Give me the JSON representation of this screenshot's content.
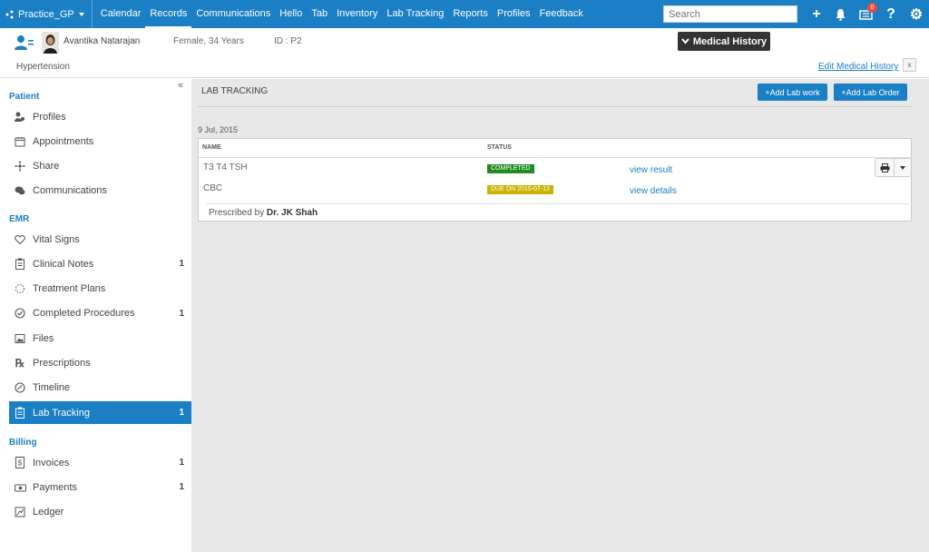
{
  "topbar": {
    "practice": "Practice_GP",
    "nav": [
      "Calendar",
      "Records",
      "Communications",
      "Hello",
      "Tab",
      "Inventory",
      "Lab Tracking",
      "Reports",
      "Profiles",
      "Feedback"
    ],
    "active_nav": "Records",
    "search_placeholder": "Search",
    "notification_count": "0",
    "accent": "#1a7fc4"
  },
  "patient": {
    "name": "Avantika Natarajan",
    "gender_age": "Female, 34 Years",
    "id": "ID : P2",
    "condition": "Hypertension",
    "medical_history_btn": "Medical History",
    "edit_medical_history": "Edit Medical History",
    "close": "x"
  },
  "sidebar": {
    "sections": [
      {
        "title": "Patient",
        "items": [
          {
            "label": "Profiles",
            "icon": "profiles-icon",
            "count": ""
          },
          {
            "label": "Appointments",
            "icon": "calendar-icon",
            "count": ""
          },
          {
            "label": "Share",
            "icon": "share-icon",
            "count": ""
          },
          {
            "label": "Communications",
            "icon": "chat-icon",
            "count": ""
          }
        ]
      },
      {
        "title": "EMR",
        "items": [
          {
            "label": "Vital Signs",
            "icon": "heart-icon",
            "count": ""
          },
          {
            "label": "Clinical Notes",
            "icon": "clipboard-icon",
            "count": "1"
          },
          {
            "label": "Treatment Plans",
            "icon": "dotted-circle-icon",
            "count": ""
          },
          {
            "label": "Completed Procedures",
            "icon": "check-circle-icon",
            "count": "1"
          },
          {
            "label": "Files",
            "icon": "image-icon",
            "count": ""
          },
          {
            "label": "Prescriptions",
            "icon": "rx-icon",
            "count": ""
          },
          {
            "label": "Timeline",
            "icon": "clock-icon",
            "count": ""
          },
          {
            "label": "Lab Tracking",
            "icon": "lab-icon",
            "count": "1",
            "active": true
          }
        ]
      },
      {
        "title": "Billing",
        "items": [
          {
            "label": "Invoices",
            "icon": "invoice-icon",
            "count": "1"
          },
          {
            "label": "Payments",
            "icon": "payment-icon",
            "count": "1"
          },
          {
            "label": "Ledger",
            "icon": "ledger-icon",
            "count": ""
          }
        ]
      }
    ]
  },
  "main": {
    "title": "LAB TRACKING",
    "add_lab_work": "+Add Lab work",
    "add_lab_order": "+Add Lab Order",
    "date": "9 Jul, 2015",
    "columns": [
      "NAME",
      "STATUS"
    ],
    "rows": [
      {
        "name": "T3 T4 TSH",
        "status": "COMPLETED",
        "status_color": "#1e8c1e",
        "link": "view result"
      },
      {
        "name": "CBC",
        "status": "DUE ON 2015-07-13",
        "status_color": "#c8b400",
        "link": "view details"
      }
    ],
    "prescribed_by_label": "Prescribed by",
    "prescribed_by": "Dr. JK Shah"
  }
}
